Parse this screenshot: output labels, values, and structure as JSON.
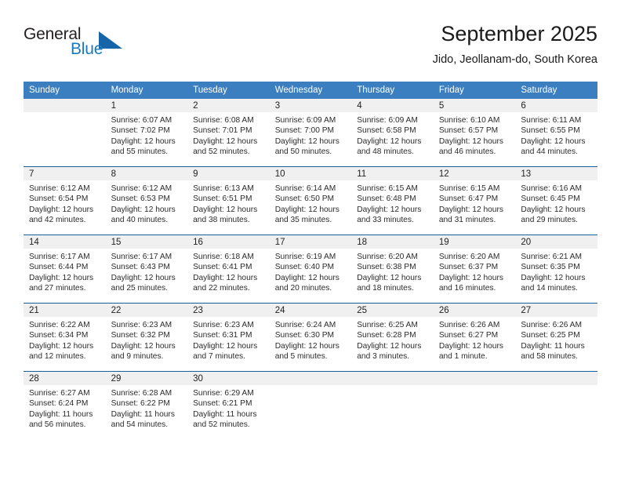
{
  "brand": {
    "name_part1": "General",
    "name_part2": "Blue",
    "triangle_color": "#1565a8",
    "blue_color": "#1a7abf"
  },
  "header": {
    "title": "September 2025",
    "subtitle": "Jido, Jeollanam-do, South Korea"
  },
  "theme": {
    "header_row_bg": "#3c7fc0",
    "daynum_band_bg": "#f0f0f0",
    "week_separator": "#17609c"
  },
  "weekday_headers": [
    "Sunday",
    "Monday",
    "Tuesday",
    "Wednesday",
    "Thursday",
    "Friday",
    "Saturday"
  ],
  "weeks": [
    [
      {
        "day": "",
        "empty": true,
        "sunrise": "",
        "sunset": "",
        "daylight_line1": "",
        "daylight_line2": ""
      },
      {
        "day": "1",
        "empty": false,
        "sunrise": "Sunrise: 6:07 AM",
        "sunset": "Sunset: 7:02 PM",
        "daylight_line1": "Daylight: 12 hours",
        "daylight_line2": "and 55 minutes."
      },
      {
        "day": "2",
        "empty": false,
        "sunrise": "Sunrise: 6:08 AM",
        "sunset": "Sunset: 7:01 PM",
        "daylight_line1": "Daylight: 12 hours",
        "daylight_line2": "and 52 minutes."
      },
      {
        "day": "3",
        "empty": false,
        "sunrise": "Sunrise: 6:09 AM",
        "sunset": "Sunset: 7:00 PM",
        "daylight_line1": "Daylight: 12 hours",
        "daylight_line2": "and 50 minutes."
      },
      {
        "day": "4",
        "empty": false,
        "sunrise": "Sunrise: 6:09 AM",
        "sunset": "Sunset: 6:58 PM",
        "daylight_line1": "Daylight: 12 hours",
        "daylight_line2": "and 48 minutes."
      },
      {
        "day": "5",
        "empty": false,
        "sunrise": "Sunrise: 6:10 AM",
        "sunset": "Sunset: 6:57 PM",
        "daylight_line1": "Daylight: 12 hours",
        "daylight_line2": "and 46 minutes."
      },
      {
        "day": "6",
        "empty": false,
        "sunrise": "Sunrise: 6:11 AM",
        "sunset": "Sunset: 6:55 PM",
        "daylight_line1": "Daylight: 12 hours",
        "daylight_line2": "and 44 minutes."
      }
    ],
    [
      {
        "day": "7",
        "empty": false,
        "sunrise": "Sunrise: 6:12 AM",
        "sunset": "Sunset: 6:54 PM",
        "daylight_line1": "Daylight: 12 hours",
        "daylight_line2": "and 42 minutes."
      },
      {
        "day": "8",
        "empty": false,
        "sunrise": "Sunrise: 6:12 AM",
        "sunset": "Sunset: 6:53 PM",
        "daylight_line1": "Daylight: 12 hours",
        "daylight_line2": "and 40 minutes."
      },
      {
        "day": "9",
        "empty": false,
        "sunrise": "Sunrise: 6:13 AM",
        "sunset": "Sunset: 6:51 PM",
        "daylight_line1": "Daylight: 12 hours",
        "daylight_line2": "and 38 minutes."
      },
      {
        "day": "10",
        "empty": false,
        "sunrise": "Sunrise: 6:14 AM",
        "sunset": "Sunset: 6:50 PM",
        "daylight_line1": "Daylight: 12 hours",
        "daylight_line2": "and 35 minutes."
      },
      {
        "day": "11",
        "empty": false,
        "sunrise": "Sunrise: 6:15 AM",
        "sunset": "Sunset: 6:48 PM",
        "daylight_line1": "Daylight: 12 hours",
        "daylight_line2": "and 33 minutes."
      },
      {
        "day": "12",
        "empty": false,
        "sunrise": "Sunrise: 6:15 AM",
        "sunset": "Sunset: 6:47 PM",
        "daylight_line1": "Daylight: 12 hours",
        "daylight_line2": "and 31 minutes."
      },
      {
        "day": "13",
        "empty": false,
        "sunrise": "Sunrise: 6:16 AM",
        "sunset": "Sunset: 6:45 PM",
        "daylight_line1": "Daylight: 12 hours",
        "daylight_line2": "and 29 minutes."
      }
    ],
    [
      {
        "day": "14",
        "empty": false,
        "sunrise": "Sunrise: 6:17 AM",
        "sunset": "Sunset: 6:44 PM",
        "daylight_line1": "Daylight: 12 hours",
        "daylight_line2": "and 27 minutes."
      },
      {
        "day": "15",
        "empty": false,
        "sunrise": "Sunrise: 6:17 AM",
        "sunset": "Sunset: 6:43 PM",
        "daylight_line1": "Daylight: 12 hours",
        "daylight_line2": "and 25 minutes."
      },
      {
        "day": "16",
        "empty": false,
        "sunrise": "Sunrise: 6:18 AM",
        "sunset": "Sunset: 6:41 PM",
        "daylight_line1": "Daylight: 12 hours",
        "daylight_line2": "and 22 minutes."
      },
      {
        "day": "17",
        "empty": false,
        "sunrise": "Sunrise: 6:19 AM",
        "sunset": "Sunset: 6:40 PM",
        "daylight_line1": "Daylight: 12 hours",
        "daylight_line2": "and 20 minutes."
      },
      {
        "day": "18",
        "empty": false,
        "sunrise": "Sunrise: 6:20 AM",
        "sunset": "Sunset: 6:38 PM",
        "daylight_line1": "Daylight: 12 hours",
        "daylight_line2": "and 18 minutes."
      },
      {
        "day": "19",
        "empty": false,
        "sunrise": "Sunrise: 6:20 AM",
        "sunset": "Sunset: 6:37 PM",
        "daylight_line1": "Daylight: 12 hours",
        "daylight_line2": "and 16 minutes."
      },
      {
        "day": "20",
        "empty": false,
        "sunrise": "Sunrise: 6:21 AM",
        "sunset": "Sunset: 6:35 PM",
        "daylight_line1": "Daylight: 12 hours",
        "daylight_line2": "and 14 minutes."
      }
    ],
    [
      {
        "day": "21",
        "empty": false,
        "sunrise": "Sunrise: 6:22 AM",
        "sunset": "Sunset: 6:34 PM",
        "daylight_line1": "Daylight: 12 hours",
        "daylight_line2": "and 12 minutes."
      },
      {
        "day": "22",
        "empty": false,
        "sunrise": "Sunrise: 6:23 AM",
        "sunset": "Sunset: 6:32 PM",
        "daylight_line1": "Daylight: 12 hours",
        "daylight_line2": "and 9 minutes."
      },
      {
        "day": "23",
        "empty": false,
        "sunrise": "Sunrise: 6:23 AM",
        "sunset": "Sunset: 6:31 PM",
        "daylight_line1": "Daylight: 12 hours",
        "daylight_line2": "and 7 minutes."
      },
      {
        "day": "24",
        "empty": false,
        "sunrise": "Sunrise: 6:24 AM",
        "sunset": "Sunset: 6:30 PM",
        "daylight_line1": "Daylight: 12 hours",
        "daylight_line2": "and 5 minutes."
      },
      {
        "day": "25",
        "empty": false,
        "sunrise": "Sunrise: 6:25 AM",
        "sunset": "Sunset: 6:28 PM",
        "daylight_line1": "Daylight: 12 hours",
        "daylight_line2": "and 3 minutes."
      },
      {
        "day": "26",
        "empty": false,
        "sunrise": "Sunrise: 6:26 AM",
        "sunset": "Sunset: 6:27 PM",
        "daylight_line1": "Daylight: 12 hours",
        "daylight_line2": "and 1 minute."
      },
      {
        "day": "27",
        "empty": false,
        "sunrise": "Sunrise: 6:26 AM",
        "sunset": "Sunset: 6:25 PM",
        "daylight_line1": "Daylight: 11 hours",
        "daylight_line2": "and 58 minutes."
      }
    ],
    [
      {
        "day": "28",
        "empty": false,
        "sunrise": "Sunrise: 6:27 AM",
        "sunset": "Sunset: 6:24 PM",
        "daylight_line1": "Daylight: 11 hours",
        "daylight_line2": "and 56 minutes."
      },
      {
        "day": "29",
        "empty": false,
        "sunrise": "Sunrise: 6:28 AM",
        "sunset": "Sunset: 6:22 PM",
        "daylight_line1": "Daylight: 11 hours",
        "daylight_line2": "and 54 minutes."
      },
      {
        "day": "30",
        "empty": false,
        "sunrise": "Sunrise: 6:29 AM",
        "sunset": "Sunset: 6:21 PM",
        "daylight_line1": "Daylight: 11 hours",
        "daylight_line2": "and 52 minutes."
      },
      {
        "day": "",
        "empty": true,
        "sunrise": "",
        "sunset": "",
        "daylight_line1": "",
        "daylight_line2": ""
      },
      {
        "day": "",
        "empty": true,
        "sunrise": "",
        "sunset": "",
        "daylight_line1": "",
        "daylight_line2": ""
      },
      {
        "day": "",
        "empty": true,
        "sunrise": "",
        "sunset": "",
        "daylight_line1": "",
        "daylight_line2": ""
      },
      {
        "day": "",
        "empty": true,
        "sunrise": "",
        "sunset": "",
        "daylight_line1": "",
        "daylight_line2": ""
      }
    ]
  ]
}
